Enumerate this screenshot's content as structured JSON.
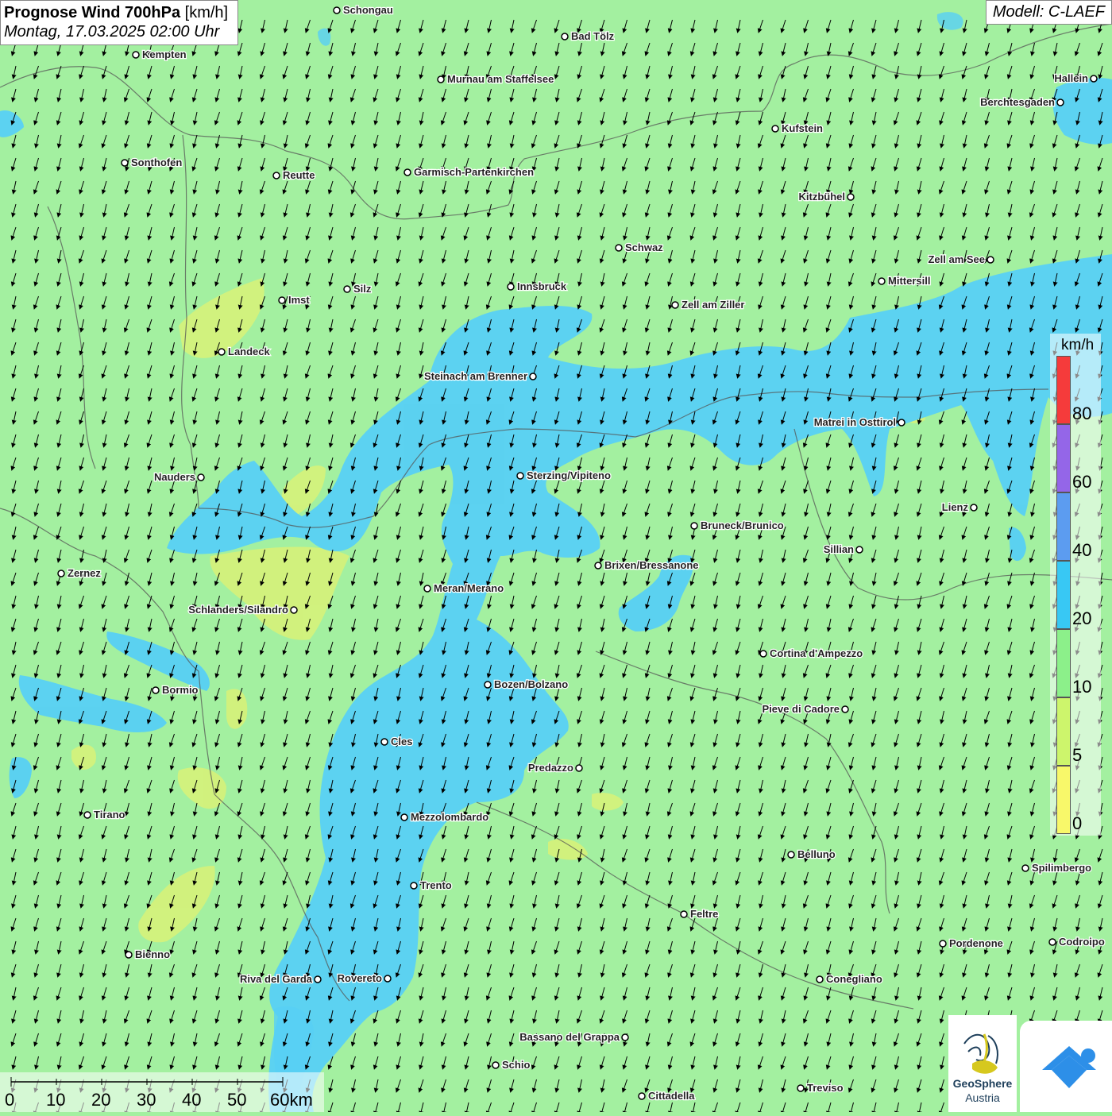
{
  "title": {
    "main": "Prognose Wind 700hPa",
    "unit": "[km/h]",
    "datetime": "Montag, 17.03.2025 02:00 Uhr"
  },
  "model": "Modell: C-LAEF",
  "legend": {
    "unit": "km/h",
    "labels": [
      "80",
      "60",
      "40",
      "20",
      "10",
      "5",
      "0"
    ],
    "colors": [
      "#f53b3b",
      "#9466e8",
      "#5c9cf0",
      "#38c8f4",
      "#8cf08a",
      "#cdf56c",
      "#f8f86a"
    ]
  },
  "colors": {
    "base": "#a3f0a0",
    "calm": "#d6f27a",
    "moderate": "#58d0f5",
    "border": "#555555"
  },
  "scale": {
    "labels": [
      "0",
      "10",
      "20",
      "30",
      "40",
      "50",
      "60km"
    ]
  },
  "cities": [
    {
      "name": "Schongau"
    },
    {
      "name": "Bad Tölz"
    },
    {
      "name": "Kempten"
    },
    {
      "name": "Murnau am Staffelsee"
    },
    {
      "name": "Hallein"
    },
    {
      "name": "Berchtesgaden"
    },
    {
      "name": "Kufstein"
    },
    {
      "name": "Sonthofen"
    },
    {
      "name": "Reutte"
    },
    {
      "name": "Garmisch-Partenkirchen"
    },
    {
      "name": "Kitzbühel"
    },
    {
      "name": "Schwaz"
    },
    {
      "name": "Zell am See"
    },
    {
      "name": "Mittersill"
    },
    {
      "name": "Innsbruck"
    },
    {
      "name": "Silz"
    },
    {
      "name": "Imst"
    },
    {
      "name": "Zell am Ziller"
    },
    {
      "name": "Landeck"
    },
    {
      "name": "Steinach am Brenner"
    },
    {
      "name": "Matrei in Osttirol"
    },
    {
      "name": "Nauders"
    },
    {
      "name": "Sterzing/Vipiteno"
    },
    {
      "name": "Lienz"
    },
    {
      "name": "Bruneck/Brunico"
    },
    {
      "name": "Sillian"
    },
    {
      "name": "Zernez"
    },
    {
      "name": "Brixen/Bressanone"
    },
    {
      "name": "Meran/Merano"
    },
    {
      "name": "Schlanders/Silandro"
    },
    {
      "name": "Cortina d'Ampezzo"
    },
    {
      "name": "Bozen/Bolzano"
    },
    {
      "name": "Bormio"
    },
    {
      "name": "Pieve di Cadore"
    },
    {
      "name": "Cles"
    },
    {
      "name": "Predazzo"
    },
    {
      "name": "Tirano"
    },
    {
      "name": "Mezzolombardo"
    },
    {
      "name": "Belluno"
    },
    {
      "name": "Spilimbergo"
    },
    {
      "name": "Trento"
    },
    {
      "name": "Feltre"
    },
    {
      "name": "Pordenone"
    },
    {
      "name": "Codroipo"
    },
    {
      "name": "Bienno"
    },
    {
      "name": "Riva del Garda"
    },
    {
      "name": "Rovereto"
    },
    {
      "name": "Conegliano"
    },
    {
      "name": "Bassano del Grappa"
    },
    {
      "name": "Schio"
    },
    {
      "name": "Treviso"
    },
    {
      "name": "Cittadella"
    }
  ],
  "logo": {
    "line1": "GeoSphere",
    "line2": "Austria"
  }
}
